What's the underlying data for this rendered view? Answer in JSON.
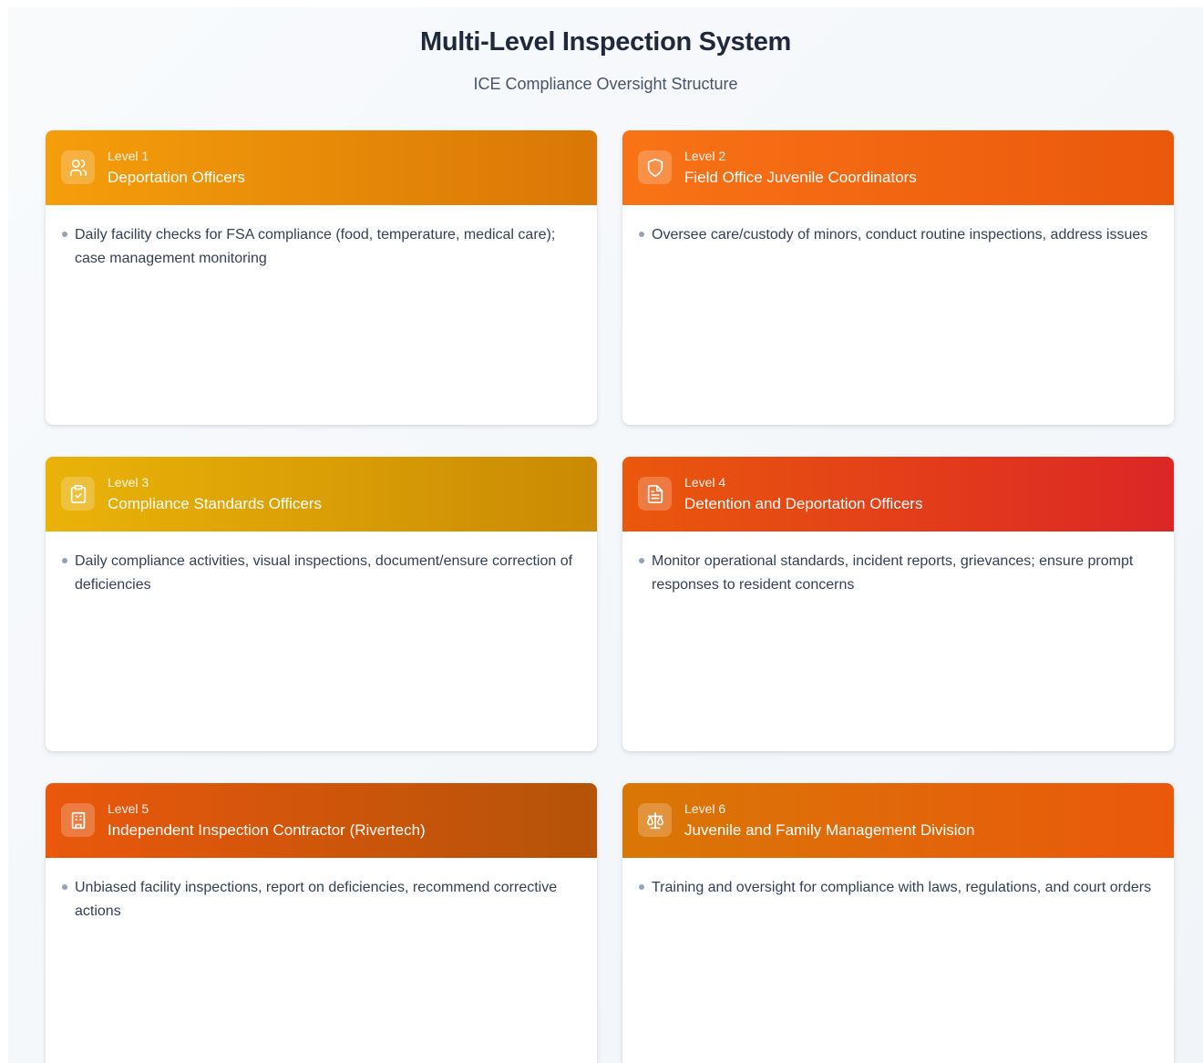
{
  "header": {
    "title": "Multi-Level Inspection System",
    "subtitle": "ICE Compliance Oversight Structure"
  },
  "levels": [
    {
      "level": "Level 1",
      "title": "Deportation Officers",
      "icon": "users-icon",
      "gradient": [
        "#f59e0b",
        "#d97706"
      ],
      "bullets": [
        "Daily facility checks for FSA compliance (food, temperature, medical care); case management monitoring"
      ]
    },
    {
      "level": "Level 2",
      "title": "Field Office Juvenile Coordinators",
      "icon": "shield-icon",
      "gradient": [
        "#f97316",
        "#ea580c"
      ],
      "bullets": [
        "Oversee care/custody of minors, conduct routine inspections, address issues"
      ]
    },
    {
      "level": "Level 3",
      "title": "Compliance Standards Officers",
      "icon": "clipboard-check-icon",
      "gradient": [
        "#eab308",
        "#ca8a04"
      ],
      "bullets": [
        "Daily compliance activities, visual inspections, document/ensure correction of deficiencies"
      ]
    },
    {
      "level": "Level 4",
      "title": "Detention and Deportation Officers",
      "icon": "file-text-icon",
      "gradient": [
        "#ea580c",
        "#dc2626"
      ],
      "bullets": [
        "Monitor operational standards, incident reports, grievances; ensure prompt responses to resident concerns"
      ]
    },
    {
      "level": "Level 5",
      "title": "Independent Inspection Contractor (Rivertech)",
      "icon": "building-icon",
      "gradient": [
        "#ea580c",
        "#b45309"
      ],
      "bullets": [
        "Unbiased facility inspections, report on deficiencies, recommend corrective actions"
      ]
    },
    {
      "level": "Level 6",
      "title": "Juvenile and Family Management Division",
      "icon": "scale-icon",
      "gradient": [
        "#d97706",
        "#ea580c"
      ],
      "bullets": [
        "Training and oversight for compliance with laws, regulations, and court orders"
      ]
    }
  ],
  "bullet_color": "#94a3b8"
}
